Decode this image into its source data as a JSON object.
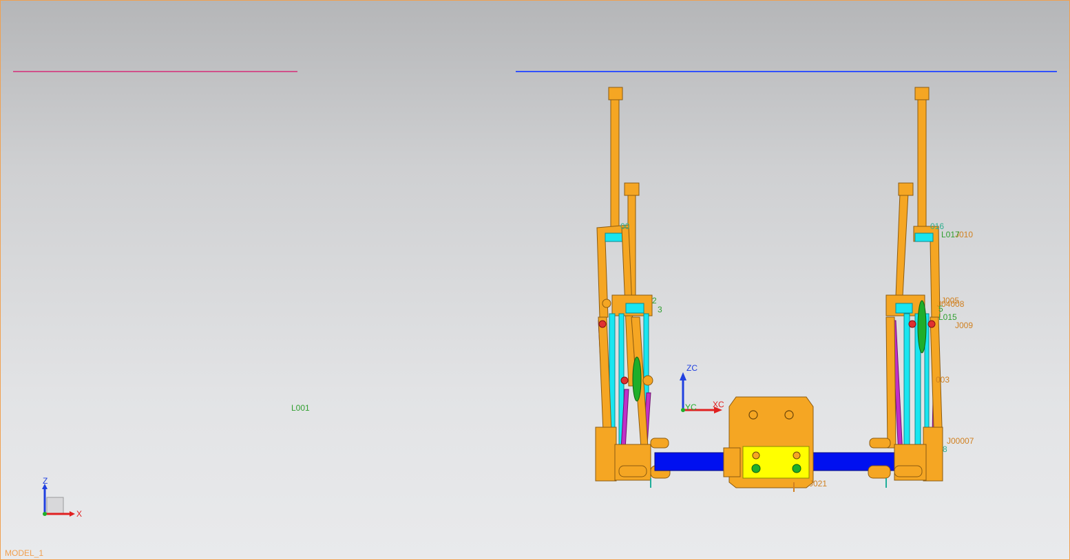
{
  "viewport": {
    "model_name": "MODEL_1",
    "colors": {
      "background_top": "#b5b6b8",
      "background_bottom": "#e9eaec",
      "border": "#f0a050",
      "part_orange": "#f5a623",
      "part_yellow": "#ffff00",
      "part_cyan": "#19e6f0",
      "part_magenta": "#c030c8",
      "part_green": "#1fae2a",
      "part_blue": "#0010f0",
      "line_pink": "#d0508a",
      "line_blue": "#3050ff",
      "label_green": "#2f9f2f",
      "label_orange": "#d08020"
    }
  },
  "triad_main": {
    "z": "Z",
    "x": "X"
  },
  "triad_wcs": {
    "zc": "ZC",
    "yc": "YC",
    "xc": "XC"
  },
  "labels": {
    "l001": "L001",
    "j021": "J021",
    "j010": "J010",
    "l017": "L017",
    "j016": "016",
    "j005": "J005",
    "j008": "J04008",
    "l015": "L015",
    "j009": "J009",
    "j003": "003",
    "j007": "J00007",
    "j_left_top": "00",
    "j_left_mid1": "2",
    "j_left_mid2": "3",
    "j_right_5": "5",
    "j_right_8": "8"
  }
}
